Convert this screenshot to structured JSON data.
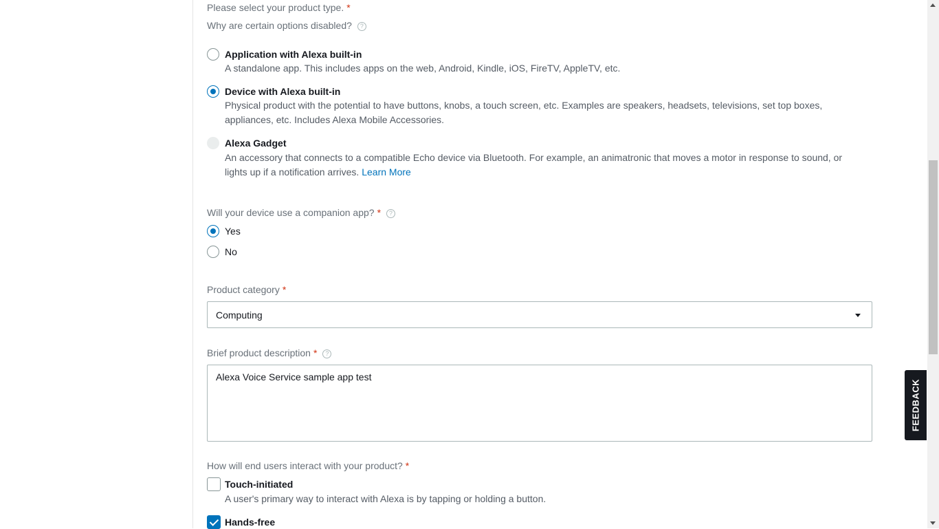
{
  "product_type": {
    "label": "Please select your product type.",
    "required_mark": "*",
    "disabled_hint": "Why are certain options disabled?",
    "options": [
      {
        "title": "Application with Alexa built-in",
        "desc": "A standalone app. This includes apps on the web, Android, Kindle, iOS, FireTV, AppleTV, etc.",
        "state": "unselected"
      },
      {
        "title": "Device with Alexa built-in",
        "desc_line1": "Physical product with the potential to have buttons, knobs, a touch screen, etc. Examples are speakers, headsets, televisions, set top boxes,",
        "desc_line2": "appliances, etc. Includes Alexa Mobile Accessories.",
        "state": "selected"
      },
      {
        "title": "Alexa Gadget",
        "desc_line1": "An accessory that connects to a compatible Echo device via Bluetooth. For example, an animatronic that moves a motor in response to sound, or",
        "desc_line2": "lights up if a notification arrives.",
        "link": "Learn More",
        "state": "disabled"
      }
    ]
  },
  "companion_app": {
    "label": "Will your device use a companion app?",
    "required_mark": "*",
    "options": [
      {
        "label": "Yes",
        "state": "selected"
      },
      {
        "label": "No",
        "state": "unselected"
      }
    ]
  },
  "product_category": {
    "label": "Product category",
    "required_mark": "*",
    "selected_value": "Computing"
  },
  "description": {
    "label": "Brief product description",
    "required_mark": "*",
    "value": "Alexa Voice Service sample app test"
  },
  "interaction": {
    "label": "How will end users interact with your product?",
    "required_mark": "*",
    "options": [
      {
        "title": "Touch-initiated",
        "desc": "A user's primary way to interact with Alexa is by tapping or holding a button.",
        "checked": false
      },
      {
        "title": "Hands-free",
        "checked": true
      }
    ]
  },
  "feedback_tab": {
    "label": "FEEDBACK"
  },
  "help_icon_glyph": "?",
  "colors": {
    "accent": "#0073bb",
    "required": "#d13212",
    "muted_text": "#687078"
  }
}
